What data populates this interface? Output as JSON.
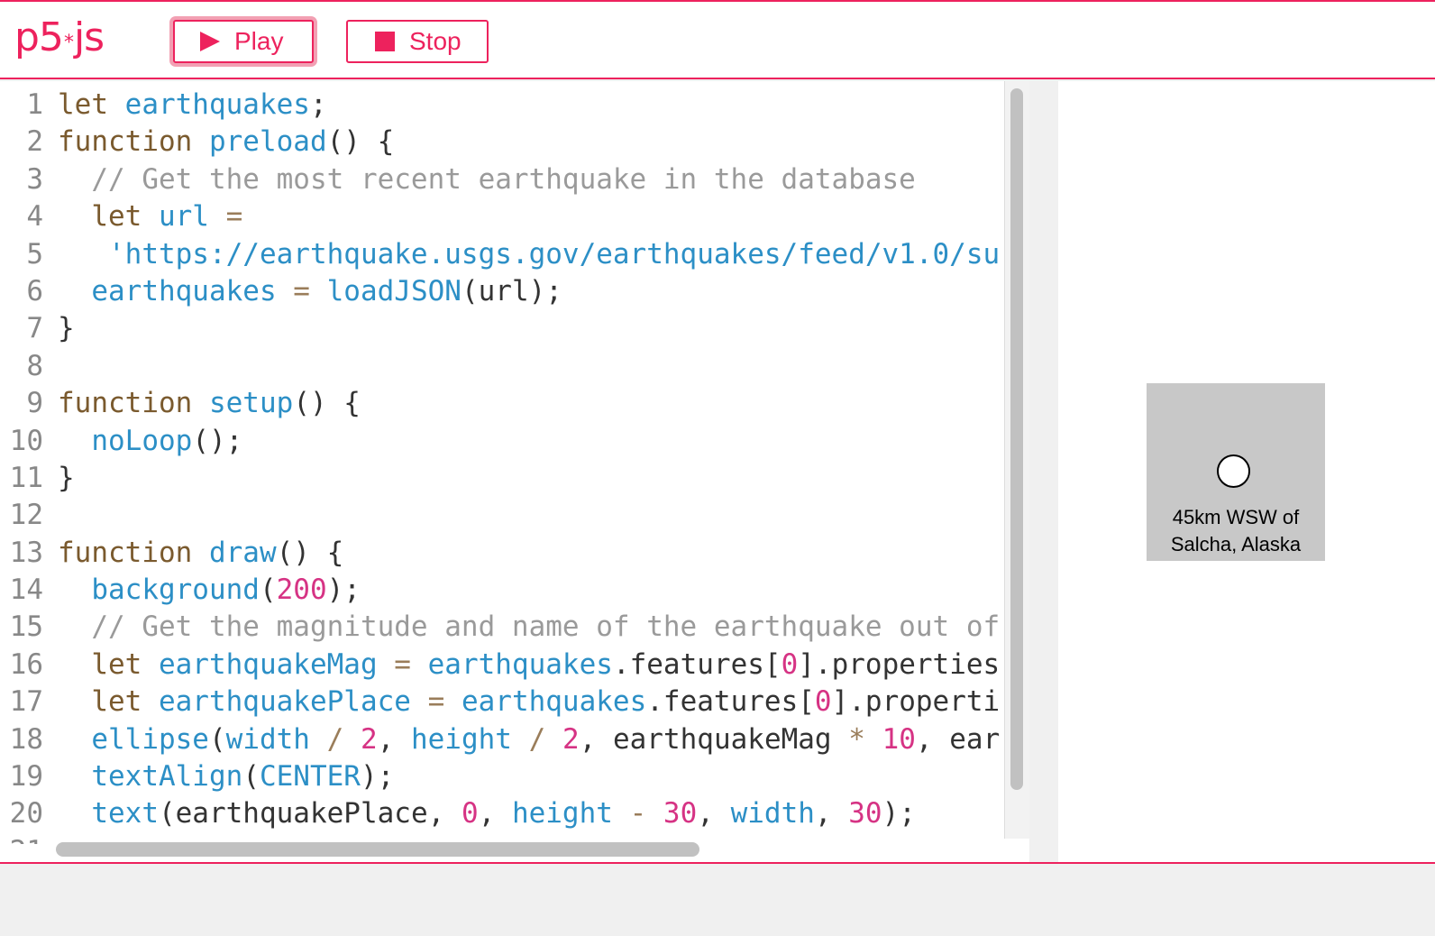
{
  "app": {
    "logo": "p5",
    "logo_star": "*",
    "logo_js": "js"
  },
  "toolbar": {
    "play_label": "Play",
    "stop_label": "Stop"
  },
  "editor": {
    "lines": [
      [
        {
          "t": "kw",
          "v": "let "
        },
        {
          "t": "var",
          "v": "earthquakes"
        },
        {
          "t": "code",
          "v": ";"
        }
      ],
      [
        {
          "t": "kw",
          "v": "function "
        },
        {
          "t": "fn",
          "v": "preload"
        },
        {
          "t": "code",
          "v": "() {"
        }
      ],
      [
        {
          "t": "cm",
          "v": "  // Get the most recent earthquake in the database"
        }
      ],
      [
        {
          "t": "kw",
          "v": "  let "
        },
        {
          "t": "var",
          "v": "url"
        },
        {
          "t": "op",
          "v": " ="
        }
      ],
      [
        {
          "t": "str",
          "v": "   'https://earthquake.usgs.gov/earthquakes/feed/v1.0/su"
        }
      ],
      [
        {
          "t": "var",
          "v": "  earthquakes"
        },
        {
          "t": "op",
          "v": " = "
        },
        {
          "t": "fn",
          "v": "loadJSON"
        },
        {
          "t": "code",
          "v": "(url);"
        }
      ],
      [
        {
          "t": "code",
          "v": "}"
        }
      ],
      [
        {
          "t": "code",
          "v": ""
        }
      ],
      [
        {
          "t": "kw",
          "v": "function "
        },
        {
          "t": "fn",
          "v": "setup"
        },
        {
          "t": "code",
          "v": "() {"
        }
      ],
      [
        {
          "t": "fn",
          "v": "  noLoop"
        },
        {
          "t": "code",
          "v": "();"
        }
      ],
      [
        {
          "t": "code",
          "v": "}"
        }
      ],
      [
        {
          "t": "code",
          "v": ""
        }
      ],
      [
        {
          "t": "kw",
          "v": "function "
        },
        {
          "t": "fn",
          "v": "draw"
        },
        {
          "t": "code",
          "v": "() {"
        }
      ],
      [
        {
          "t": "fn",
          "v": "  background"
        },
        {
          "t": "code",
          "v": "("
        },
        {
          "t": "num",
          "v": "200"
        },
        {
          "t": "code",
          "v": ");"
        }
      ],
      [
        {
          "t": "cm",
          "v": "  // Get the magnitude and name of the earthquake out of"
        }
      ],
      [
        {
          "t": "kw",
          "v": "  let "
        },
        {
          "t": "var",
          "v": "earthquakeMag"
        },
        {
          "t": "op",
          "v": " = "
        },
        {
          "t": "var",
          "v": "earthquakes"
        },
        {
          "t": "code",
          "v": ".features["
        },
        {
          "t": "num",
          "v": "0"
        },
        {
          "t": "code",
          "v": "].properties"
        }
      ],
      [
        {
          "t": "kw",
          "v": "  let "
        },
        {
          "t": "var",
          "v": "earthquakePlace"
        },
        {
          "t": "op",
          "v": " = "
        },
        {
          "t": "var",
          "v": "earthquakes"
        },
        {
          "t": "code",
          "v": ".features["
        },
        {
          "t": "num",
          "v": "0"
        },
        {
          "t": "code",
          "v": "].properti"
        }
      ],
      [
        {
          "t": "fn",
          "v": "  ellipse"
        },
        {
          "t": "code",
          "v": "("
        },
        {
          "t": "var",
          "v": "width"
        },
        {
          "t": "op",
          "v": " / "
        },
        {
          "t": "num",
          "v": "2"
        },
        {
          "t": "code",
          "v": ", "
        },
        {
          "t": "var",
          "v": "height"
        },
        {
          "t": "op",
          "v": " / "
        },
        {
          "t": "num",
          "v": "2"
        },
        {
          "t": "code",
          "v": ", earthquakeMag "
        },
        {
          "t": "op",
          "v": "* "
        },
        {
          "t": "num",
          "v": "10"
        },
        {
          "t": "code",
          "v": ", ear"
        }
      ],
      [
        {
          "t": "fn",
          "v": "  textAlign"
        },
        {
          "t": "code",
          "v": "("
        },
        {
          "t": "var",
          "v": "CENTER"
        },
        {
          "t": "code",
          "v": ");"
        }
      ],
      [
        {
          "t": "fn",
          "v": "  text"
        },
        {
          "t": "code",
          "v": "(earthquakePlace, "
        },
        {
          "t": "num",
          "v": "0"
        },
        {
          "t": "code",
          "v": ", "
        },
        {
          "t": "var",
          "v": "height"
        },
        {
          "t": "op",
          "v": " - "
        },
        {
          "t": "num",
          "v": "30"
        },
        {
          "t": "code",
          "v": ", "
        },
        {
          "t": "var",
          "v": "width"
        },
        {
          "t": "code",
          "v": ", "
        },
        {
          "t": "num",
          "v": "30"
        },
        {
          "t": "code",
          "v": ");"
        }
      ],
      [
        {
          "t": "code",
          "v": ""
        }
      ]
    ]
  },
  "preview": {
    "place_text": "45km WSW of Salcha, Alaska"
  },
  "colors": {
    "accent": "#ed225d",
    "canvas_bg": "#c8c8c8"
  }
}
